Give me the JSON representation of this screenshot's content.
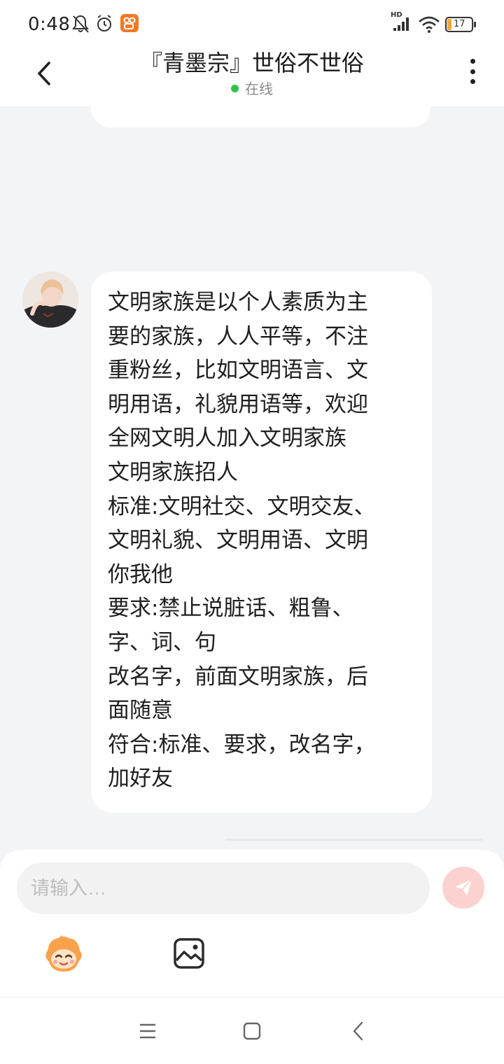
{
  "status_bar": {
    "time": "0:48",
    "network_label": "HD",
    "battery": "17",
    "icons": [
      "mute-bell-icon",
      "alarm-icon",
      "app-notification-icon",
      "signal-icon",
      "wifi-icon",
      "battery-icon"
    ]
  },
  "header": {
    "title": "『青墨宗』世俗不世俗",
    "status": "在线",
    "status_color": "#2fc24a"
  },
  "message": {
    "lines": [
      "文明家族是以个人素质为主",
      "要的家族，人人平等，不注",
      "重粉丝，比如文明语言、文",
      "明用语，礼貌用语等，欢迎",
      "全网文明人加入文明家族",
      "文明家族招人",
      "标准:文明社交、文明交友、",
      "文明礼貌、文明用语、文明",
      "你我他",
      "要求:禁止说脏话、粗鲁、",
      "字、词、句",
      "改名字，前面文明家族，后",
      "面随意",
      "符合:标准、要求，改名字，",
      "加好友"
    ]
  },
  "composer": {
    "placeholder": "请输入…",
    "send_color": "#fbd2cf"
  },
  "colors": {
    "background": "#f3f4f6",
    "bubble": "#ffffff",
    "accent": "#f26b5b"
  }
}
